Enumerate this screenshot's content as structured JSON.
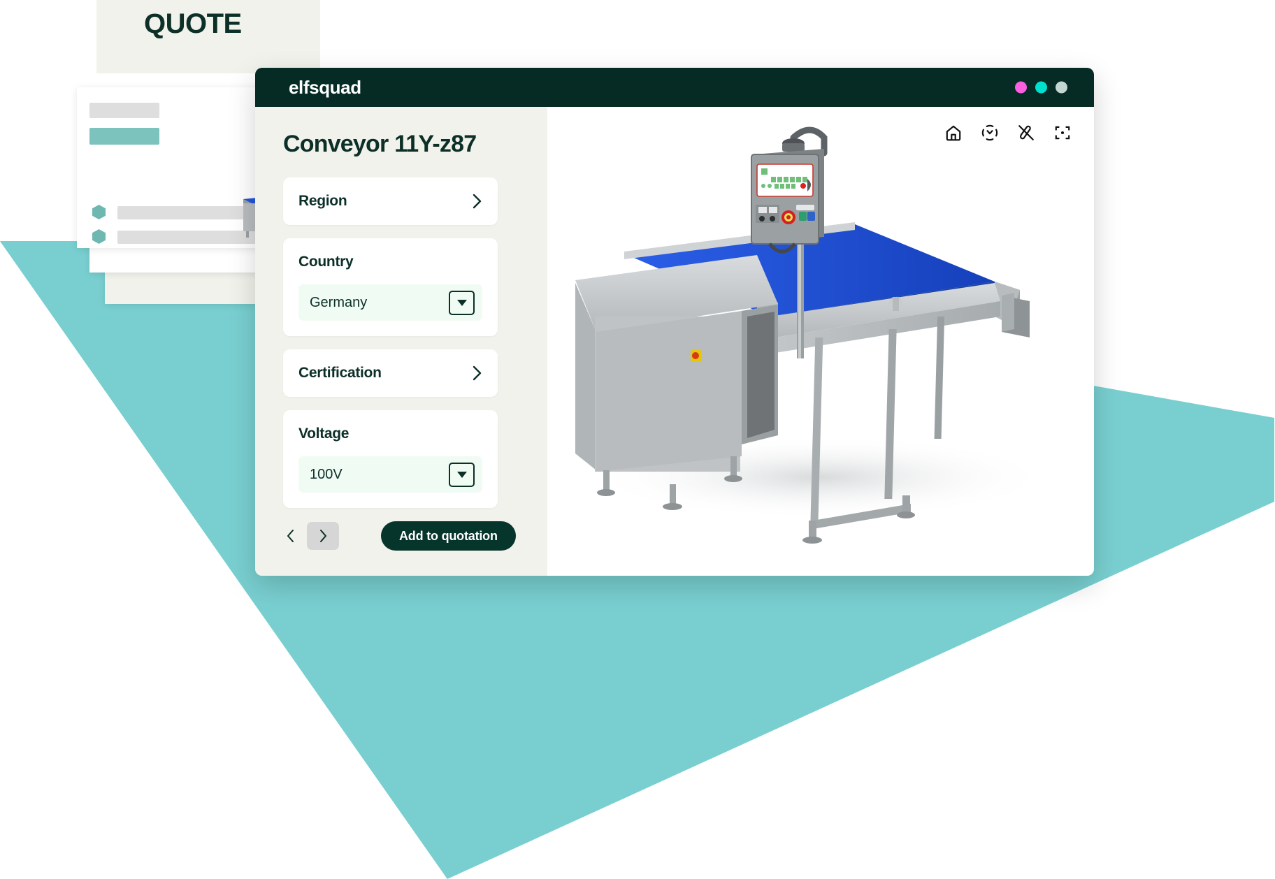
{
  "background": {
    "quote_card": {
      "title": "QUOTE"
    },
    "accent_color": "#79cfd0",
    "doc_bullet_color": "#6fb7b1",
    "doc_bar_color": "#dedede"
  },
  "window": {
    "titlebar": {
      "brand": "elfsquad",
      "background": "#062a24",
      "dots": [
        {
          "name": "dot-magenta",
          "color": "#f95fe0"
        },
        {
          "name": "dot-cyan",
          "color": "#00e0cf"
        },
        {
          "name": "dot-grey",
          "color": "#c3d6d1"
        }
      ]
    },
    "panel": {
      "title": "Conveyor 11Y-z87",
      "fields": [
        {
          "label": "Region",
          "type": "navigate",
          "icon": "chevron-right-icon"
        },
        {
          "label": "Country",
          "type": "select",
          "value": "Germany",
          "icon": "chevron-down-icon"
        },
        {
          "label": "Certification",
          "type": "navigate",
          "icon": "chevron-right-icon"
        },
        {
          "label": "Voltage",
          "type": "select",
          "value": "100V",
          "icon": "chevron-down-icon"
        }
      ],
      "footer": {
        "prev_icon": "chevron-left-icon",
        "next_icon": "chevron-right-icon",
        "add_button_label": "Add to quotation",
        "add_button_color": "#06352b"
      }
    },
    "viewport": {
      "tools": [
        {
          "name": "home-icon",
          "label": "Home view"
        },
        {
          "name": "orbit-icon",
          "label": "Orbit"
        },
        {
          "name": "hide-layer-icon",
          "label": "Hide"
        },
        {
          "name": "focus-icon",
          "label": "Fit to screen"
        }
      ],
      "model": {
        "name": "conveyor-3d-model",
        "belt_color": "#1e51d8",
        "frame_color": "#b6b9bb",
        "panel_screen_color": "#eef3ec",
        "estop_color": "#e02020"
      }
    }
  }
}
